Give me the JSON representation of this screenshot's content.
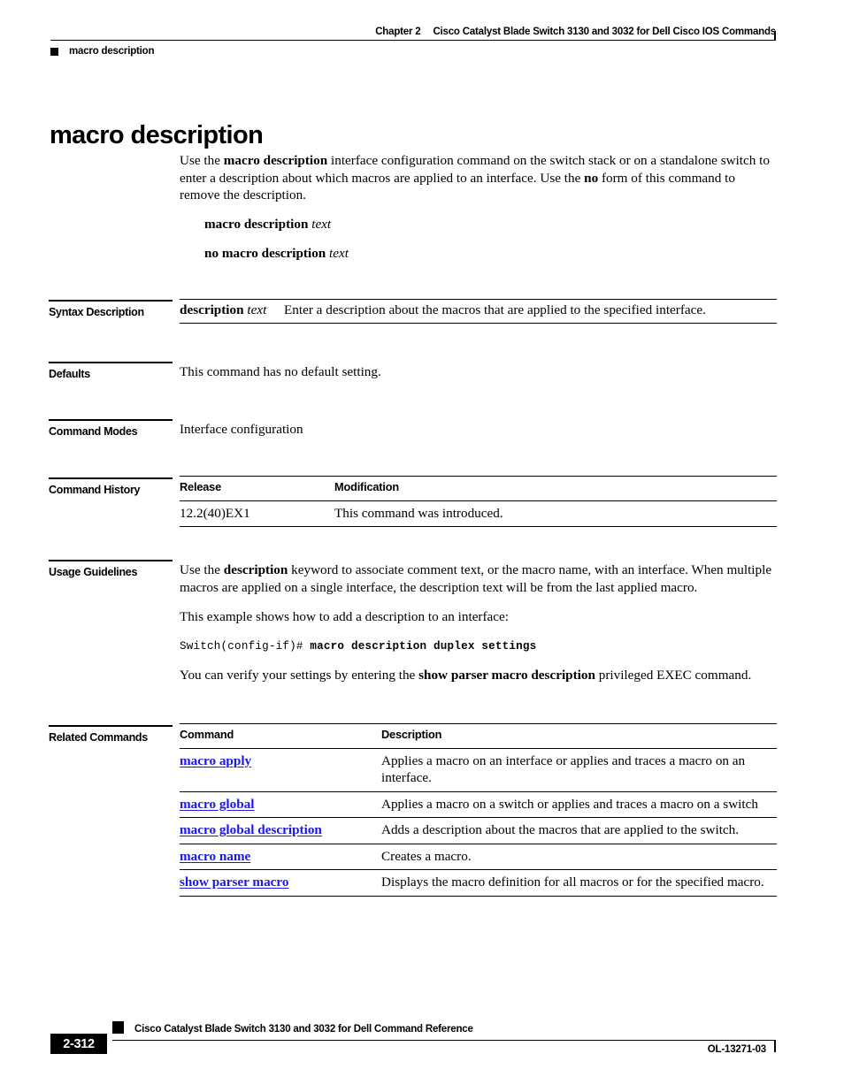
{
  "header": {
    "chapter": "Chapter 2",
    "book_title": "Cisco Catalyst Blade Switch 3130 and 3032 for Dell Cisco IOS Commands",
    "topic": "macro description"
  },
  "title": "macro description",
  "intro": {
    "part1": "Use the ",
    "bold1": "macro description",
    "part2": " interface configuration command on the switch stack or on a standalone switch to enter a description about which macros are applied to an interface. Use the ",
    "bold2": "no",
    "part3": " form of this command to remove the description."
  },
  "syntax_lines": [
    {
      "command": "macro description",
      "arg": "text"
    },
    {
      "command": "no macro description",
      "arg": "text"
    }
  ],
  "sections": {
    "syntax_description": {
      "label": "Syntax Description",
      "term_bold": "description",
      "term_italic": "text",
      "definition": "Enter a description about the macros that are applied to the specified interface."
    },
    "defaults": {
      "label": "Defaults",
      "text": "This command has no default setting."
    },
    "command_modes": {
      "label": "Command Modes",
      "text": "Interface configuration"
    },
    "command_history": {
      "label": "Command History",
      "columns": [
        "Release",
        "Modification"
      ],
      "rows": [
        {
          "release": "12.2(40)EX1",
          "modification": "This command was introduced."
        }
      ]
    },
    "usage_guidelines": {
      "label": "Usage Guidelines",
      "p1_part1": "Use the ",
      "p1_bold": "description",
      "p1_part2": " keyword to associate comment text, or the macro name, with an interface. When multiple macros are applied on a single interface, the description text will be from the last applied macro.",
      "p2": "This example shows how to add a description to an interface:",
      "cli_prompt": "Switch(config-if)# ",
      "cli_command": "macro description duplex settings",
      "p3_part1": "You can verify your settings by entering the ",
      "p3_bold": "show parser macro description",
      "p3_part2": " privileged EXEC command."
    },
    "related_commands": {
      "label": "Related Commands",
      "columns": [
        "Command",
        "Description"
      ],
      "rows": [
        {
          "command": "macro apply",
          "description": "Applies a macro on an interface or applies and traces a macro on an interface."
        },
        {
          "command": "macro global",
          "description": "Applies a macro on a switch or applies and traces a macro on a switch"
        },
        {
          "command": "macro global description",
          "description": "Adds a description about the macros that are applied to the switch."
        },
        {
          "command": "macro name",
          "description": "Creates a macro."
        },
        {
          "command": "show parser macro",
          "description": "Displays the macro definition for all macros or for the specified macro."
        }
      ]
    }
  },
  "footer": {
    "book_title": "Cisco Catalyst Blade Switch 3130 and 3032 for Dell Command Reference",
    "page_number": "2-312",
    "doc_id": "OL-13271-03"
  },
  "colors": {
    "link": "#1a17e8",
    "text": "#000000",
    "background": "#ffffff"
  }
}
